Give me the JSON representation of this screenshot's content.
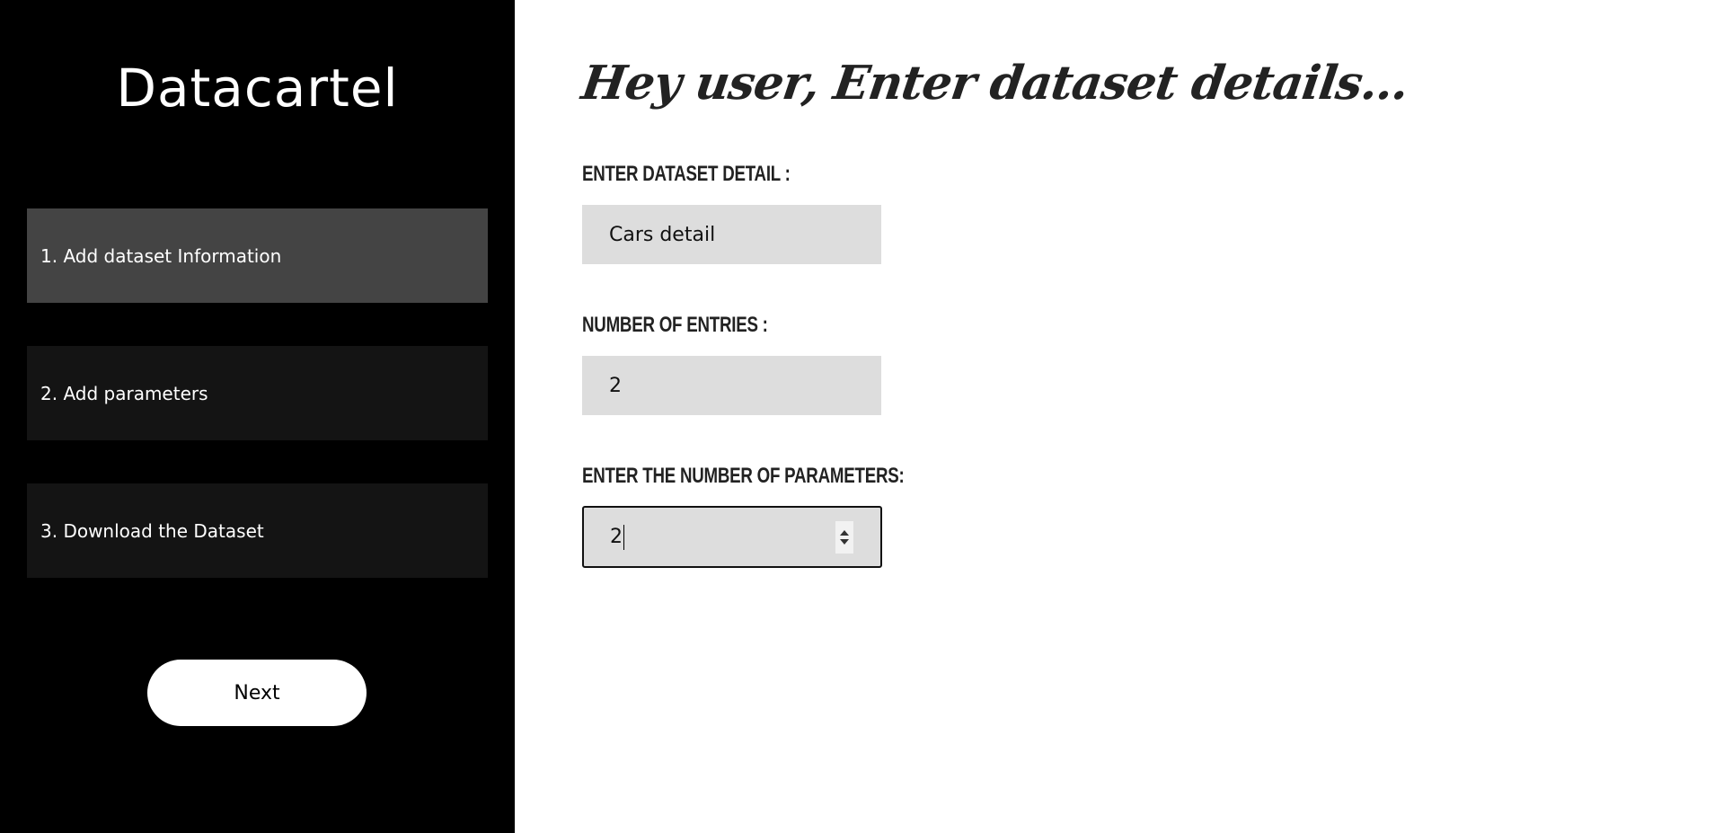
{
  "sidebar": {
    "brand": "Datacartel",
    "steps": [
      {
        "label": "1. Add dataset Information",
        "active": true
      },
      {
        "label": "2. Add parameters",
        "active": false
      },
      {
        "label": "3. Download the Dataset",
        "active": false
      }
    ],
    "next_label": "Next"
  },
  "main": {
    "heading": "Hey user, Enter dataset details...",
    "fields": [
      {
        "label": "Enter dataset detail :",
        "value": "Cars detail"
      },
      {
        "label": "Number of Entries :",
        "value": "2"
      },
      {
        "label": "Enter the number of parameters:",
        "value": "2"
      }
    ]
  },
  "colors": {
    "sidebar_bg": "#000000",
    "step_bg": "#141414",
    "step_active_bg": "#444444",
    "input_bg": "#dddddd",
    "text_dark": "#222222"
  }
}
